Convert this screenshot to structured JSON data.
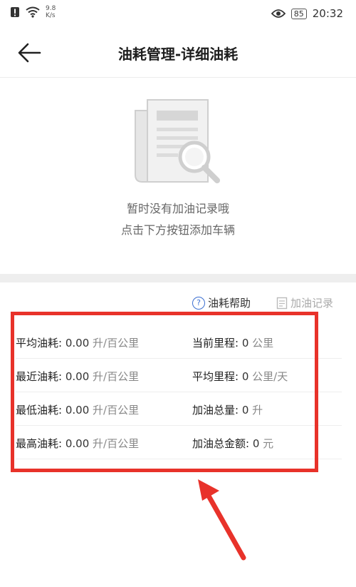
{
  "status_bar": {
    "speed_value": "9.8",
    "speed_unit": "K/s",
    "battery": "85",
    "time": "20:32"
  },
  "nav": {
    "title": "油耗管理-详细油耗"
  },
  "empty_state": {
    "line1": "暂时没有加油记录哦",
    "line2": "点击下方按钮添加车辆"
  },
  "links": {
    "help": "油耗帮助",
    "help_icon_glyph": "?",
    "record": "加油记录"
  },
  "stats": [
    {
      "left": {
        "label": "平均油耗:",
        "value": "0.00",
        "unit": "升/百公里"
      },
      "right": {
        "label": "当前里程:",
        "value": "0",
        "unit": "公里"
      }
    },
    {
      "left": {
        "label": "最近油耗:",
        "value": "0.00",
        "unit": "升/百公里"
      },
      "right": {
        "label": "平均里程:",
        "value": "0",
        "unit": "公里/天"
      }
    },
    {
      "left": {
        "label": "最低油耗:",
        "value": "0.00",
        "unit": "升/百公里"
      },
      "right": {
        "label": "加油总量:",
        "value": "0",
        "unit": "升"
      }
    },
    {
      "left": {
        "label": "最高油耗:",
        "value": "0.00",
        "unit": "升/百公里"
      },
      "right": {
        "label": "加油总金额:",
        "value": "0",
        "unit": "元"
      }
    }
  ],
  "icons": [
    "alert-icon",
    "wifi-icon",
    "eye-icon",
    "battery-icon",
    "back-arrow-icon",
    "document-search-icon",
    "help-circle-icon",
    "record-icon"
  ],
  "colors": {
    "highlight": "#e8322a",
    "help_icon": "#3b6fd1",
    "divider": "#eeeeee"
  }
}
